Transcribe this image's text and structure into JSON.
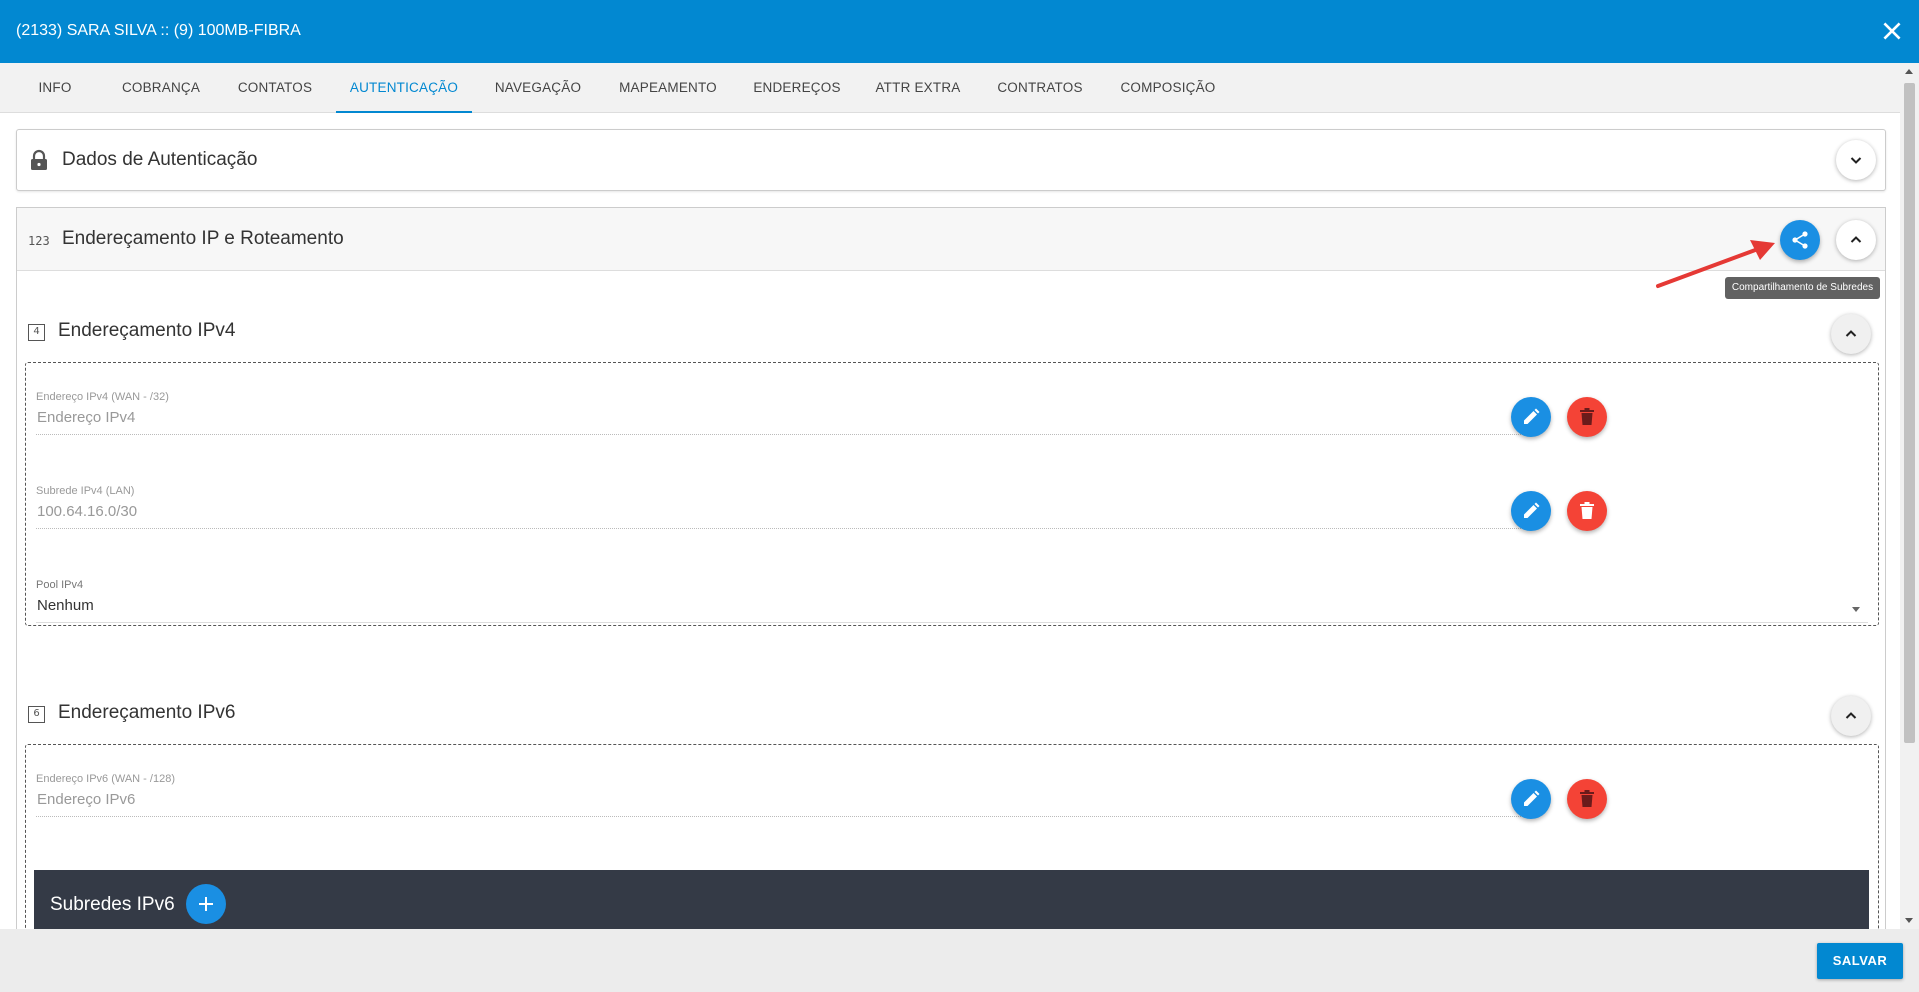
{
  "window": {
    "title": "(2133) SARA SILVA :: (9) 100MB-FIBRA"
  },
  "tabs": [
    {
      "label": "INFO"
    },
    {
      "label": "COBRANÇA"
    },
    {
      "label": "CONTATOS"
    },
    {
      "label": "AUTENTICAÇÃO",
      "active": true
    },
    {
      "label": "NAVEGAÇÃO"
    },
    {
      "label": "MAPEAMENTO"
    },
    {
      "label": "ENDEREÇOS"
    },
    {
      "label": "ATTR EXTRA"
    },
    {
      "label": "CONTRATOS"
    },
    {
      "label": "COMPOSIÇÃO"
    }
  ],
  "panels": {
    "auth": {
      "title": "Dados de Autenticação",
      "icon": "lock-icon"
    },
    "ip": {
      "title": "Endereçamento IP e Roteamento",
      "icon_text": "123",
      "tooltip": "Compartilhamento de Subredes"
    }
  },
  "ipv4": {
    "title": "Endereçamento IPv4",
    "icon_text": "4",
    "wan": {
      "label": "Endereço IPv4 (WAN - /32)",
      "placeholder": "Endereço IPv4"
    },
    "lan": {
      "label": "Subrede IPv4 (LAN)",
      "value": "100.64.16.0/30"
    },
    "pool": {
      "label": "Pool IPv4",
      "value": "Nenhum"
    }
  },
  "ipv6": {
    "title": "Endereçamento IPv6",
    "icon_text": "6",
    "wan": {
      "label": "Endereço IPv6 (WAN - /128)",
      "placeholder": "Endereço IPv6"
    },
    "subnets_title": "Subredes IPv6"
  },
  "footer": {
    "save_label": "SALVAR"
  },
  "colors": {
    "primary": "#0288d1",
    "fab_blue": "#1a8fe3",
    "delete_red": "#f44336",
    "dark_bar": "#343a46",
    "annotation_arrow": "#e53935"
  }
}
